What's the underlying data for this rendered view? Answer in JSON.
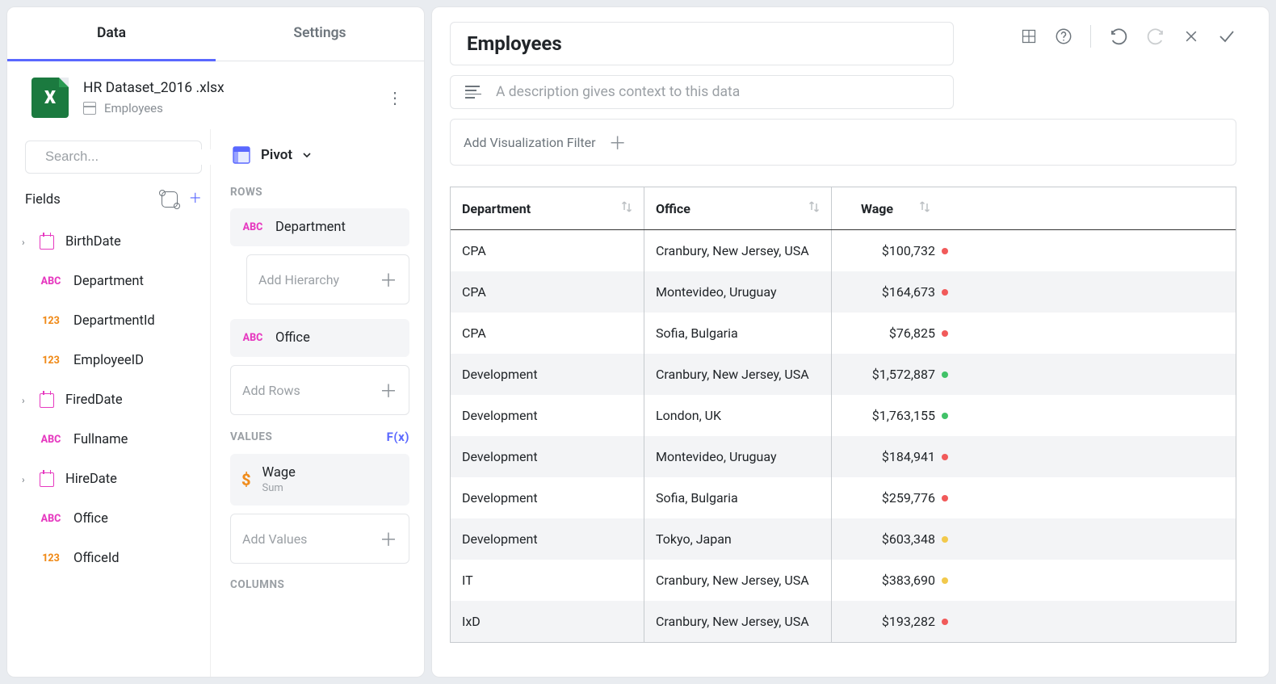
{
  "sidebar": {
    "tabs": {
      "data": "Data",
      "settings": "Settings"
    },
    "file": {
      "name": "HR Dataset_2016 .xlsx",
      "sheet": "Employees"
    },
    "search": {
      "placeholder": "Search..."
    },
    "fields": {
      "header": "Fields",
      "items": [
        {
          "name": "BirthDate",
          "typeIcon": "date",
          "expandable": true
        },
        {
          "name": "Department",
          "typeIcon": "abc",
          "expandable": false
        },
        {
          "name": "DepartmentId",
          "typeIcon": "num",
          "expandable": false
        },
        {
          "name": "EmployeeID",
          "typeIcon": "num",
          "expandable": false
        },
        {
          "name": "FiredDate",
          "typeIcon": "date",
          "expandable": true
        },
        {
          "name": "Fullname",
          "typeIcon": "abc",
          "expandable": false
        },
        {
          "name": "HireDate",
          "typeIcon": "date",
          "expandable": true
        },
        {
          "name": "Office",
          "typeIcon": "abc",
          "expandable": false
        },
        {
          "name": "OfficeId",
          "typeIcon": "num",
          "expandable": false
        }
      ]
    },
    "builder": {
      "vizLabel": "Pivot",
      "sections": {
        "rows": "ROWS",
        "values": "VALUES",
        "columns": "COLUMNS",
        "fx": "F(x)"
      },
      "rows": [
        {
          "label": "Department",
          "type": "abc"
        },
        {
          "label": "Office",
          "type": "abc"
        }
      ],
      "addHierarchy": "Add Hierarchy",
      "addRows": "Add Rows",
      "values": [
        {
          "label": "Wage",
          "sub": "Sum",
          "icon": "dollar"
        }
      ],
      "addValues": "Add Values"
    }
  },
  "main": {
    "title": "Employees",
    "descPlaceholder": "A description gives context to this data",
    "filterLabel": "Add Visualization Filter"
  },
  "table": {
    "columns": [
      "Department",
      "Office",
      "Wage"
    ],
    "rows": [
      {
        "c1": "CPA",
        "c2": "Cranbury, New Jersey, USA",
        "c3": "$100,732",
        "dot": "r"
      },
      {
        "c1": "CPA",
        "c2": "Montevideo, Uruguay",
        "c3": "$164,673",
        "dot": "r"
      },
      {
        "c1": "CPA",
        "c2": "Sofia, Bulgaria",
        "c3": "$76,825",
        "dot": "r"
      },
      {
        "c1": "Development",
        "c2": "Cranbury, New Jersey, USA",
        "c3": "$1,572,887",
        "dot": "g"
      },
      {
        "c1": "Development",
        "c2": "London, UK",
        "c3": "$1,763,155",
        "dot": "g"
      },
      {
        "c1": "Development",
        "c2": "Montevideo, Uruguay",
        "c3": "$184,941",
        "dot": "r"
      },
      {
        "c1": "Development",
        "c2": "Sofia, Bulgaria",
        "c3": "$259,776",
        "dot": "r"
      },
      {
        "c1": "Development",
        "c2": "Tokyo, Japan",
        "c3": "$603,348",
        "dot": "y"
      },
      {
        "c1": "IT",
        "c2": "Cranbury, New Jersey, USA",
        "c3": "$383,690",
        "dot": "y"
      },
      {
        "c1": "IxD",
        "c2": "Cranbury, New Jersey, USA",
        "c3": "$193,282",
        "dot": "r"
      }
    ]
  },
  "typeTags": {
    "abc": "ABC",
    "num": "123"
  }
}
